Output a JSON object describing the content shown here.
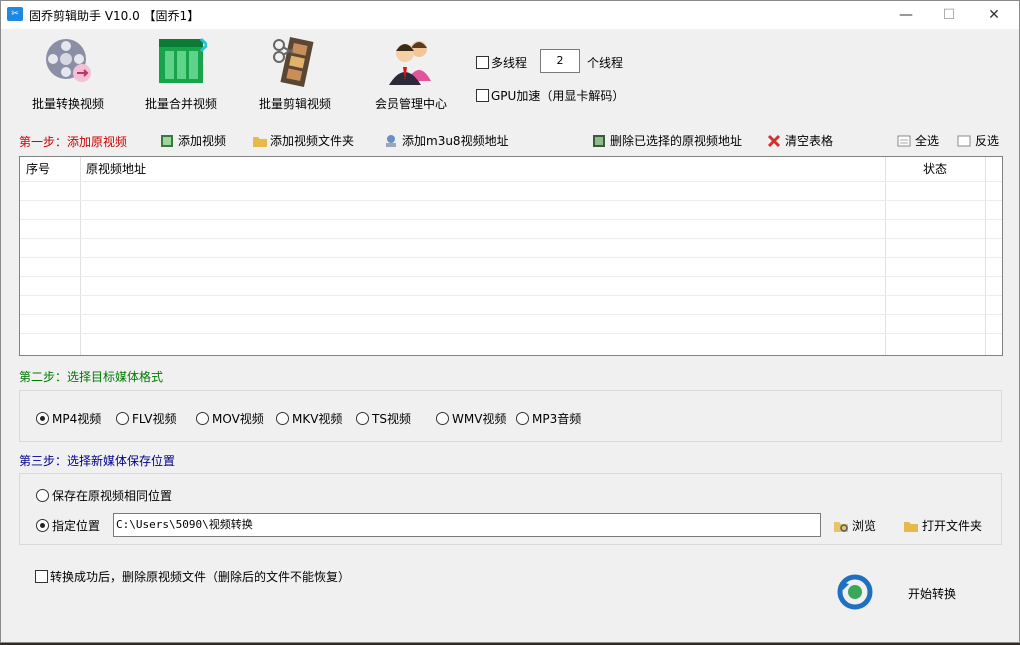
{
  "window": {
    "title": "固乔剪辑助手 V10.0  【固乔1】",
    "controls": [
      "—",
      "☐",
      "✕"
    ]
  },
  "toolbar": {
    "items": [
      {
        "label": "批量转换视频",
        "icon": "film-reel-convert-icon"
      },
      {
        "label": "批量合并视频",
        "icon": "green-merge-grid-icon"
      },
      {
        "label": "批量剪辑视频",
        "icon": "film-strip-scissors-icon"
      },
      {
        "label": "会员管理中心",
        "icon": "members-icon"
      }
    ],
    "multithread_label": "多线程",
    "thread_count": "2",
    "thread_suffix": "个线程",
    "gpu_label": "GPU加速（用显卡解码）"
  },
  "step1": {
    "label": "第一步：添加原视频",
    "add_video": "添加视频",
    "add_folder": "添加视频文件夹",
    "add_m3u8": "添加m3u8视频地址",
    "delete_selected": "删除已选择的原视频地址",
    "clear_table": "清空表格",
    "select_all": "全选",
    "invert": "反选"
  },
  "table": {
    "columns": [
      "序号",
      "原视频地址",
      "状态"
    ],
    "rows": []
  },
  "step2": {
    "label": "第二步：选择目标媒体格式",
    "formats": [
      "MP4视频",
      "FLV视频",
      "MOV视频",
      "MKV视频",
      "TS视频",
      "WMV视频",
      "MP3音频"
    ],
    "selected": "MP4视频"
  },
  "step3": {
    "label": "第三步：选择新媒体保存位置",
    "same_location": "保存在原视频相同位置",
    "custom_location": "指定位置",
    "path": "C:\\Users\\5090\\视频转换",
    "browse": "浏览",
    "open_folder": "打开文件夹"
  },
  "footer": {
    "delete_after": "转换成功后，删除原视频文件（删除后的文件不能恢复）",
    "start": "开始转换"
  },
  "colors": {
    "step1": "#cc0000",
    "step2": "#007a00",
    "step3": "#00008b"
  }
}
